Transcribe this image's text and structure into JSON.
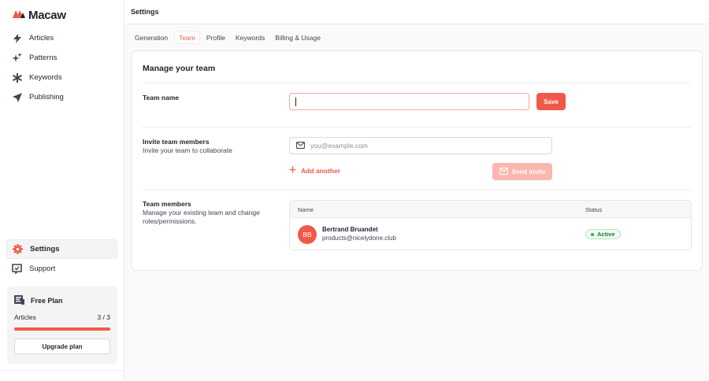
{
  "app": {
    "name": "Macaw",
    "accent": "#ef5a48"
  },
  "sidebar": {
    "items": [
      {
        "label": "Articles",
        "icon": "bolt-icon"
      },
      {
        "label": "Patterns",
        "icon": "sparkles-icon"
      },
      {
        "label": "Keywords",
        "icon": "asterisk-icon"
      },
      {
        "label": "Publishing",
        "icon": "paper-plane-icon"
      }
    ],
    "bottom_items": [
      {
        "label": "Settings",
        "icon": "gear-icon",
        "active": true
      },
      {
        "label": "Support",
        "icon": "chat-icon"
      }
    ],
    "plan": {
      "title": "Free Plan",
      "usage_label": "Articles",
      "usage_value": "3 / 3",
      "usage_fraction": 1.0,
      "upgrade_label": "Upgrade plan"
    }
  },
  "header": {
    "title": "Settings"
  },
  "tabs": [
    {
      "label": "Generation"
    },
    {
      "label": "Team",
      "active": true
    },
    {
      "label": "Profile"
    },
    {
      "label": "Keywords"
    },
    {
      "label": "Billing & Usage"
    }
  ],
  "team": {
    "heading": "Manage your team",
    "name_section": {
      "label": "Team name",
      "value": "",
      "save_label": "Save"
    },
    "invite_section": {
      "title": "Invite team members",
      "subtitle": "Invite your team to collaborate",
      "email_placeholder": "you@example.com",
      "add_another_label": "Add another",
      "send_label": "Send invite"
    },
    "members_section": {
      "title": "Team members",
      "subtitle": "Manage your existing team and change roles/permissions.",
      "columns": [
        "Name",
        "Status"
      ],
      "rows": [
        {
          "initials": "BB",
          "name": "Bertrand Bruandet",
          "email": "products@nicelydone.club",
          "status": "Active"
        }
      ]
    }
  }
}
